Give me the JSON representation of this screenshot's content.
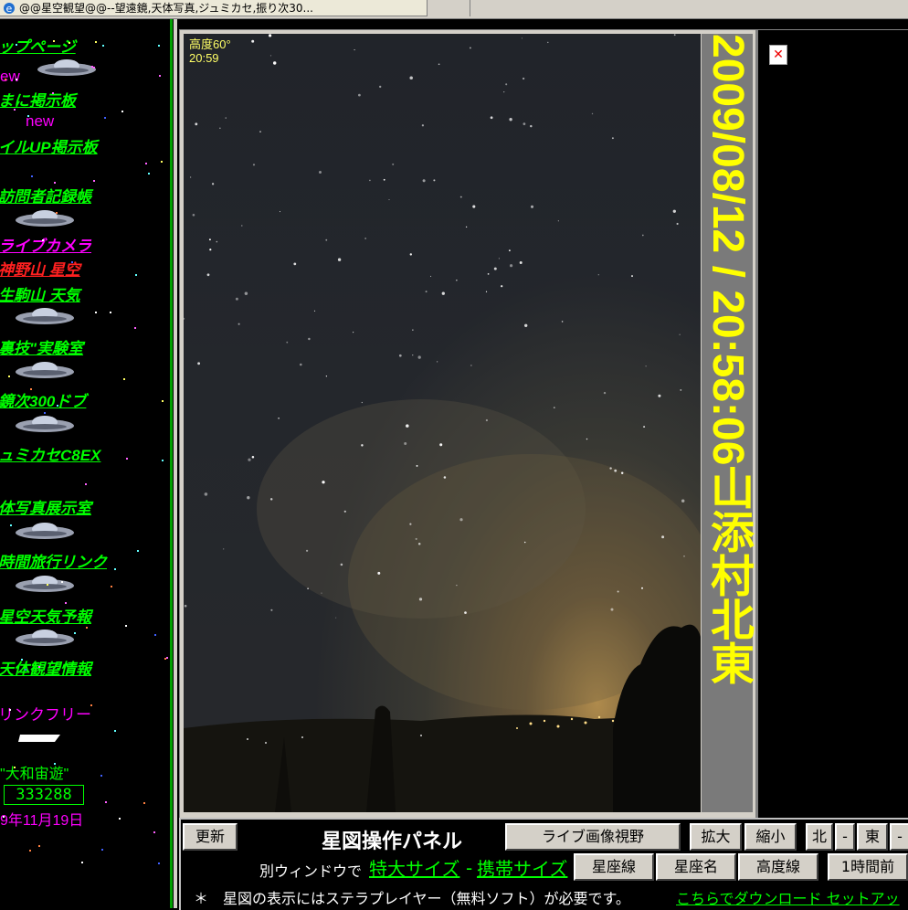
{
  "browser": {
    "tab_title": "@@星空観望@@--望遠鏡,天体写真,ジュミカセ,振り次30..."
  },
  "nav": {
    "items": [
      {
        "label": "ップページ",
        "kind": "link",
        "color": "#00ff00"
      },
      {
        "label": "ew",
        "kind": "new"
      },
      {
        "label": "まに掲示板",
        "kind": "link",
        "color": "#00ff00"
      },
      {
        "label": "new",
        "kind": "new"
      },
      {
        "label": "イルUP掲示板",
        "kind": "link",
        "color": "#00ff00"
      },
      {
        "label": "訪問者記録帳",
        "kind": "link",
        "color": "#00ff00"
      },
      {
        "label": "ライブカメラ",
        "kind": "link",
        "color": "#ff00ff"
      },
      {
        "label": "神野山 星空",
        "kind": "link",
        "color": "#ff0000"
      },
      {
        "label": "生駒山 天気",
        "kind": "link",
        "color": "#00ff00"
      },
      {
        "label": "裏技\"実験室",
        "kind": "link",
        "color": "#00ff00"
      },
      {
        "label": "鏡次300ドブ",
        "kind": "link",
        "color": "#00ff00"
      },
      {
        "label": "ュミカセC8EX",
        "kind": "link",
        "color": "#00ff00"
      },
      {
        "label": "体写真展示室",
        "kind": "link",
        "color": "#00ff00"
      },
      {
        "label": "時間旅行リンク",
        "kind": "link",
        "color": "#00ff00"
      },
      {
        "label": "星空天気予報",
        "kind": "link",
        "color": "#00ff00"
      },
      {
        "label": "天体観望情報",
        "kind": "link",
        "color": "#00ff00"
      },
      {
        "label": "リンクフリー",
        "kind": "link",
        "color": "#ff00ff"
      }
    ],
    "site_name": "\"大和宙遊\"",
    "counter": "333288",
    "start_date": "9年11月19日"
  },
  "camera": {
    "altitude_label": "高度60°",
    "time_label": "20:59",
    "stamp": "2009/08/12 / 20:58:06山添村北東"
  },
  "panel": {
    "update_label": "更新",
    "title": "星図操作パネル",
    "live_view_label": "ライブ画像視野",
    "zoom_in_label": "拡大",
    "zoom_out_label": "縮小",
    "north_label": "北",
    "dash1": "-",
    "east_label": "東",
    "dash2": "-",
    "separate_window_text": "別ウィンドウで",
    "xl_size_link": "特大サイズ",
    "hyphen": "-",
    "mobile_size_link": "携帯サイズ",
    "constellation_lines_label": "星座線",
    "constellation_names_label": "星座名",
    "altitude_lines_label": "高度線",
    "hour_before_label": "1時間前"
  },
  "footer": {
    "note": "＊　星図の表示にはステラプレイヤー（無料ソフト）が必要です。",
    "download_link": "こちらでダウンロード セットアッ"
  },
  "colors": {
    "nav_link": "#00ff00",
    "nav_new": "#ff00ff",
    "stamp_text": "#ffff00",
    "stamp_bg": "#7a7a7a"
  }
}
